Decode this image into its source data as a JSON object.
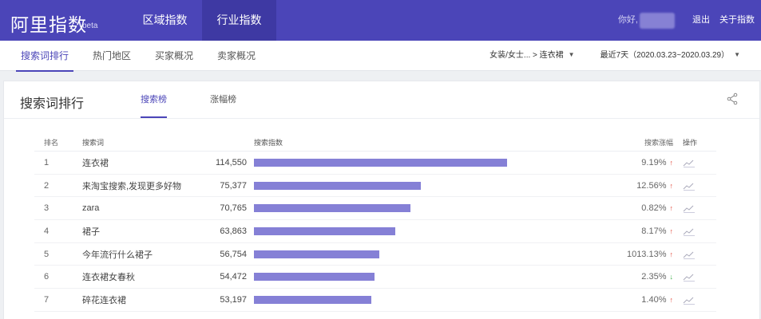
{
  "header": {
    "logo": "阿里指数",
    "logo_beta": "beta",
    "nav": [
      {
        "label": "区域指数",
        "active": false
      },
      {
        "label": "行业指数",
        "active": true
      }
    ],
    "greeting": "你好,",
    "logout": "退出",
    "about": "关于指数"
  },
  "subnav": {
    "tabs": [
      {
        "label": "搜索词排行",
        "active": true
      },
      {
        "label": "热门地区",
        "active": false
      },
      {
        "label": "买家概况",
        "active": false
      },
      {
        "label": "卖家概况",
        "active": false
      }
    ],
    "category": "女装/女士... > 连衣裙",
    "date_range": "最近7天（2020.03.23~2020.03.29）"
  },
  "panel": {
    "title": "搜索词排行",
    "tabs": [
      {
        "label": "搜索榜",
        "active": true
      },
      {
        "label": "涨幅榜",
        "active": false
      }
    ]
  },
  "table": {
    "headers": {
      "rank": "排名",
      "word": "搜索词",
      "index": "搜索指数",
      "change": "搜索涨幅",
      "ops": "操作"
    },
    "max_index": 114550,
    "rows": [
      {
        "rank": "1",
        "word": "连衣裙",
        "index": "114,550",
        "index_value": 114550,
        "change": "9.19%",
        "dir": "up"
      },
      {
        "rank": "2",
        "word": "来淘宝搜索,发现更多好物",
        "index": "75,377",
        "index_value": 75377,
        "change": "12.56%",
        "dir": "up"
      },
      {
        "rank": "3",
        "word": "zara",
        "index": "70,765",
        "index_value": 70765,
        "change": "0.82%",
        "dir": "up"
      },
      {
        "rank": "4",
        "word": "裙子",
        "index": "63,863",
        "index_value": 63863,
        "change": "8.17%",
        "dir": "up"
      },
      {
        "rank": "5",
        "word": "今年流行什么裙子",
        "index": "56,754",
        "index_value": 56754,
        "change": "1013.13%",
        "dir": "up"
      },
      {
        "rank": "6",
        "word": "连衣裙女春秋",
        "index": "54,472",
        "index_value": 54472,
        "change": "2.35%",
        "dir": "down"
      },
      {
        "rank": "7",
        "word": "碎花连衣裙",
        "index": "53,197",
        "index_value": 53197,
        "change": "1.40%",
        "dir": "up"
      }
    ]
  }
}
